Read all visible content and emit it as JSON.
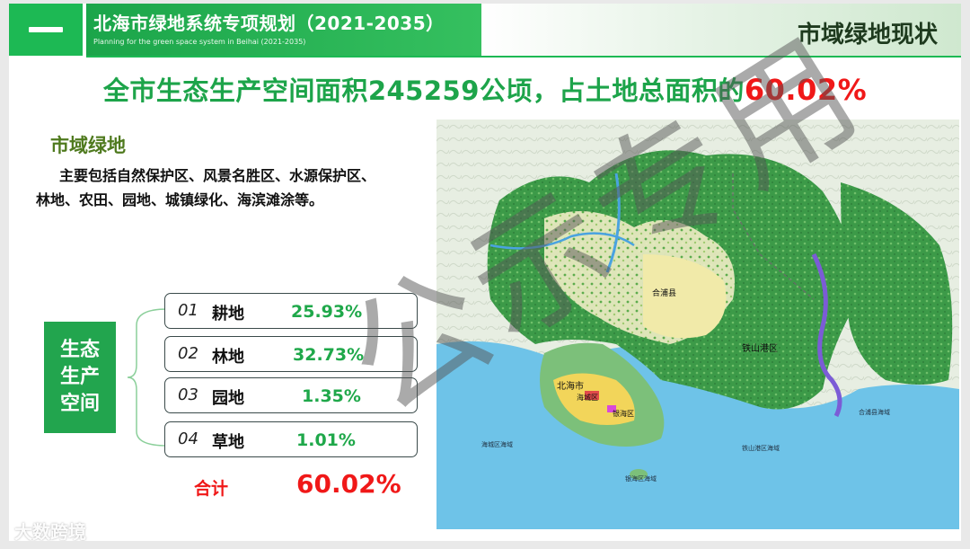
{
  "header": {
    "title": "北海市绿地系统专项规划（2021-2035）",
    "subtitle": "Planning for the green space system in Beihai (2021-2035)",
    "section_title": "市域绿地现状"
  },
  "headline": {
    "text": "全市生态生产空间面积245259公顷，占土地总面积的",
    "highlight": "60.02%"
  },
  "section": {
    "title": "市域绿地",
    "desc_line1": "主要包括自然保护区、风景名胜区、水源保护区、",
    "desc_line2": "林地、农田、园地、城镇绿化、海滨滩涂等。"
  },
  "eco_space": {
    "line1": "生态",
    "line2": "生产",
    "line3": "空间"
  },
  "items": [
    {
      "num": "01",
      "name": "耕地",
      "percent": "25.93%"
    },
    {
      "num": "02",
      "name": "林地",
      "percent": "32.73%"
    },
    {
      "num": "03",
      "name": "园地",
      "percent": "1.35%"
    },
    {
      "num": "04",
      "name": "草地",
      "percent": "1.01%"
    }
  ],
  "total": {
    "label": "合计",
    "value": "60.02%"
  },
  "map": {
    "labels": {
      "city": "北海市",
      "tieshan": "铁山港区",
      "haicheng": "海城区",
      "yinhai": "银海区",
      "hepu": "合浦县",
      "sea_haicheng": "海城区海域",
      "sea_yinhai": "银海区海域",
      "sea_tieshan": "铁山港区海域",
      "sea_hepu": "合浦县海域"
    }
  },
  "watermark": "公示专用",
  "footer_logo": "大数跨境",
  "colors": {
    "accent_green": "#1db954",
    "highlight_red": "#f01818",
    "text_green": "#1da44a"
  }
}
